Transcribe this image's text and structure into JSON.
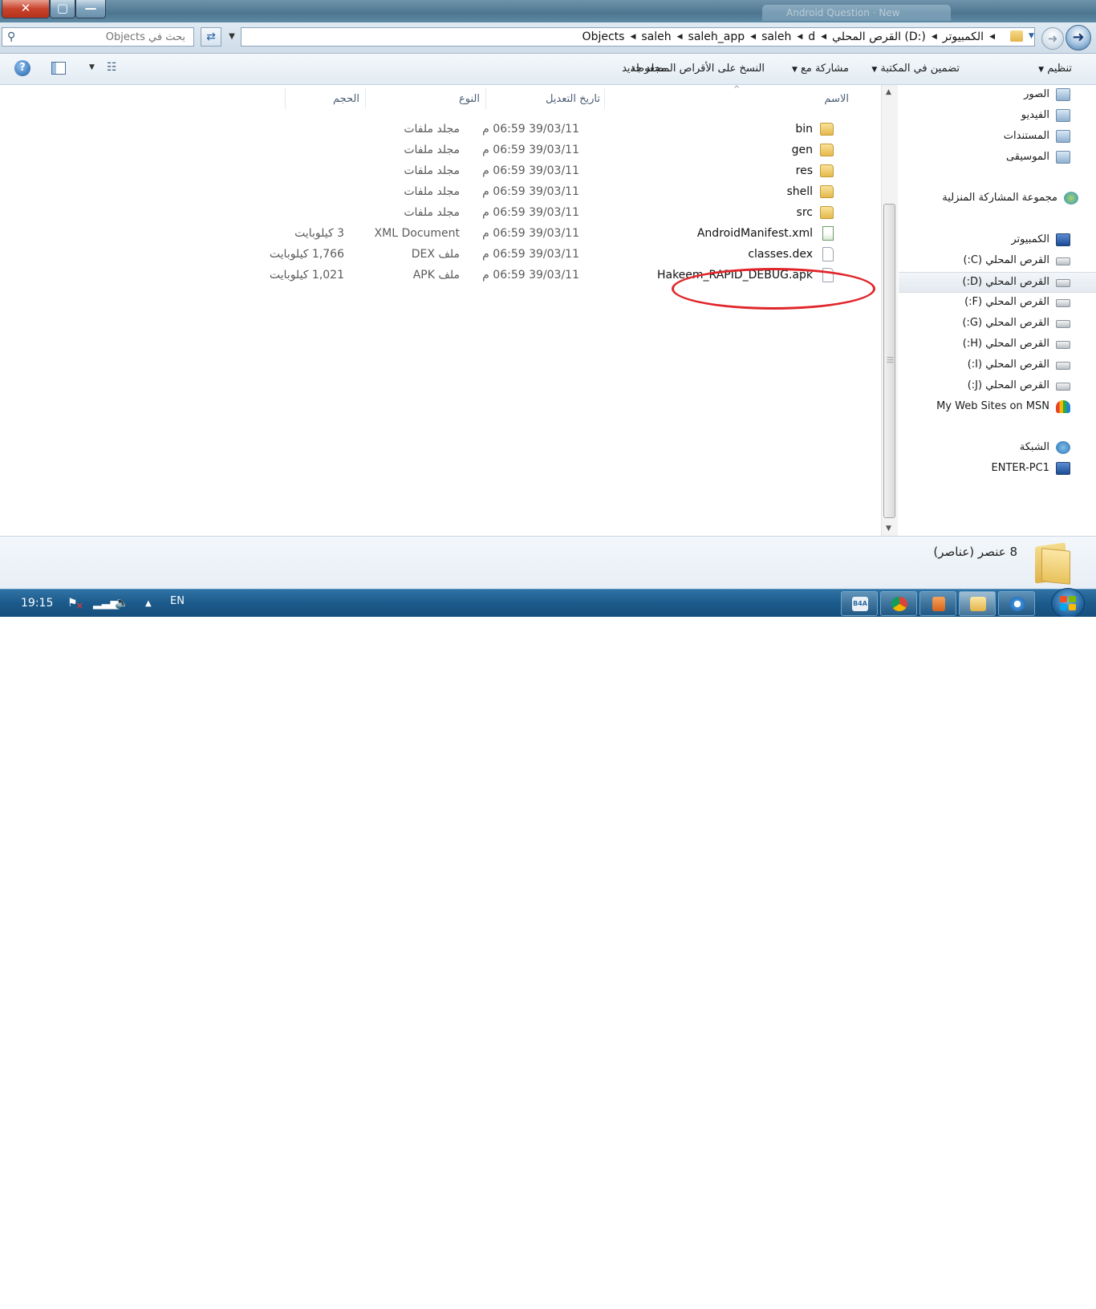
{
  "titlebar": {
    "close_label": "✕",
    "max_label": "▢",
    "min_label": "—",
    "background_tab": "Android Question · New"
  },
  "search": {
    "placeholder": "بحث في Objects"
  },
  "breadcrumbs": [
    "الكمبيوتر",
    "القرص المحلي (D:)",
    "d",
    "saleh",
    "saleh_app",
    "saleh",
    "Objects"
  ],
  "commands": {
    "organize": "تنظيم",
    "include_library": "تضمين في المكتبة",
    "share_with": "مشاركة مع",
    "burn": "النسخ على الأقراص المضغوطة",
    "new_folder": "مجلد جديد"
  },
  "columns": {
    "name": "الاسم",
    "date_modified": "تاريخ التعديل",
    "type": "النوع",
    "size": "الحجم"
  },
  "files": [
    {
      "name": "bin",
      "date": "39/03/11 06:59 م",
      "type": "مجلد ملفات",
      "size": "",
      "icon": "folder-icon"
    },
    {
      "name": "gen",
      "date": "39/03/11 06:59 م",
      "type": "مجلد ملفات",
      "size": "",
      "icon": "folder-icon"
    },
    {
      "name": "res",
      "date": "39/03/11 06:59 م",
      "type": "مجلد ملفات",
      "size": "",
      "icon": "folder-icon"
    },
    {
      "name": "shell",
      "date": "39/03/11 06:59 م",
      "type": "مجلد ملفات",
      "size": "",
      "icon": "folder-icon"
    },
    {
      "name": "src",
      "date": "39/03/11 06:59 م",
      "type": "مجلد ملفات",
      "size": "",
      "icon": "folder-icon"
    },
    {
      "name": "AndroidManifest.xml",
      "date": "39/03/11 06:59 م",
      "type": "XML Document",
      "size": "3 كيلوبايت",
      "icon": "xml-file-icon"
    },
    {
      "name": "classes.dex",
      "date": "39/03/11 06:59 م",
      "type": "ملف DEX",
      "size": "1,766 كيلوبايت",
      "icon": "file-icon"
    },
    {
      "name": "Hakeem_RAPID_DEBUG.apk",
      "date": "39/03/11 06:59 م",
      "type": "ملف APK",
      "size": "1,021 كيلوبايت",
      "icon": "file-icon"
    }
  ],
  "nav": {
    "pictures": "الصور",
    "videos": "الفيديو",
    "documents": "المستندات",
    "music": "الموسيقى",
    "homegroup": "مجموعة المشاركة المنزلية",
    "computer": "الكمبيوتر",
    "drives": [
      "القرص المحلي (C:)",
      "القرص المحلي (D:)",
      "القرص المحلي (F:)",
      "القرص المحلي (G:)",
      "القرص المحلي (H:)",
      "القرص المحلي (I:)",
      "القرص المحلي (J:)"
    ],
    "msn": "My Web Sites on MSN",
    "network": "الشبكة",
    "pc": "ENTER-PC1"
  },
  "details": {
    "item_count": "8 عنصر (عناصر)"
  },
  "taskbar": {
    "clock": "19:15",
    "lang": "EN",
    "b4a_label": "B4A"
  },
  "colors": {
    "highlight_ring": "#e0262b",
    "taskbar": "#1b5a8a"
  }
}
